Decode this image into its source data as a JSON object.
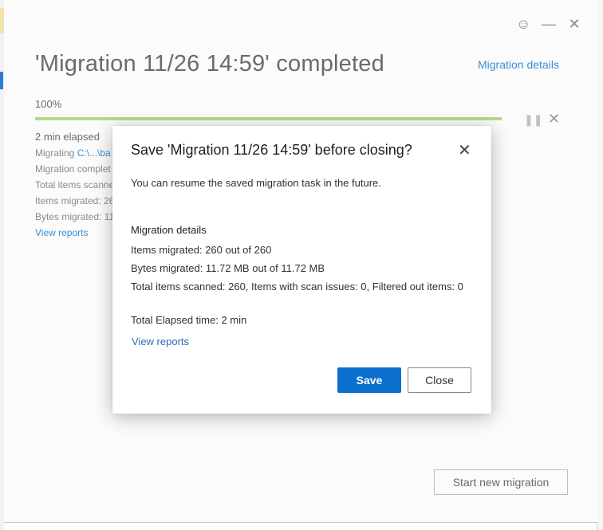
{
  "window": {
    "title": "'Migration 11/26 14:59' completed",
    "details_link": "Migration details",
    "progress_percent_label": "100%",
    "progress_value": 1.0,
    "elapsed": "2 min elapsed",
    "migrating_label": "Migrating",
    "migrating_path": "C:\\...\\ba",
    "status_truncated": "Migration complet",
    "scanned_truncated": "Total items scanne",
    "items_truncated": "Items migrated: 26",
    "bytes_truncated": "Bytes migrated: 11",
    "view_reports": "View reports",
    "start_new": "Start new migration",
    "icons": [
      "smiley-icon",
      "minimize-icon",
      "close-icon",
      "pause-icon",
      "cancel-icon"
    ]
  },
  "modal": {
    "title": "Save 'Migration 11/26 14:59' before closing?",
    "subtitle": "You can resume the saved migration task in the future.",
    "details_heading": "Migration details",
    "items_migrated": "Items migrated: 260 out of 260",
    "bytes_migrated": "Bytes migrated: 11.72 MB out of 11.72 MB",
    "total_scanned": "Total items scanned: 260, Items with scan issues: 0, Filtered out items: 0",
    "elapsed_time": "Total Elapsed time: 2 min",
    "view_reports": "View reports",
    "save_label": "Save",
    "close_label": "Close"
  },
  "colors": {
    "accent": "#0b6fd0",
    "link": "#3a8fd6",
    "progress": "#b6d98a"
  }
}
